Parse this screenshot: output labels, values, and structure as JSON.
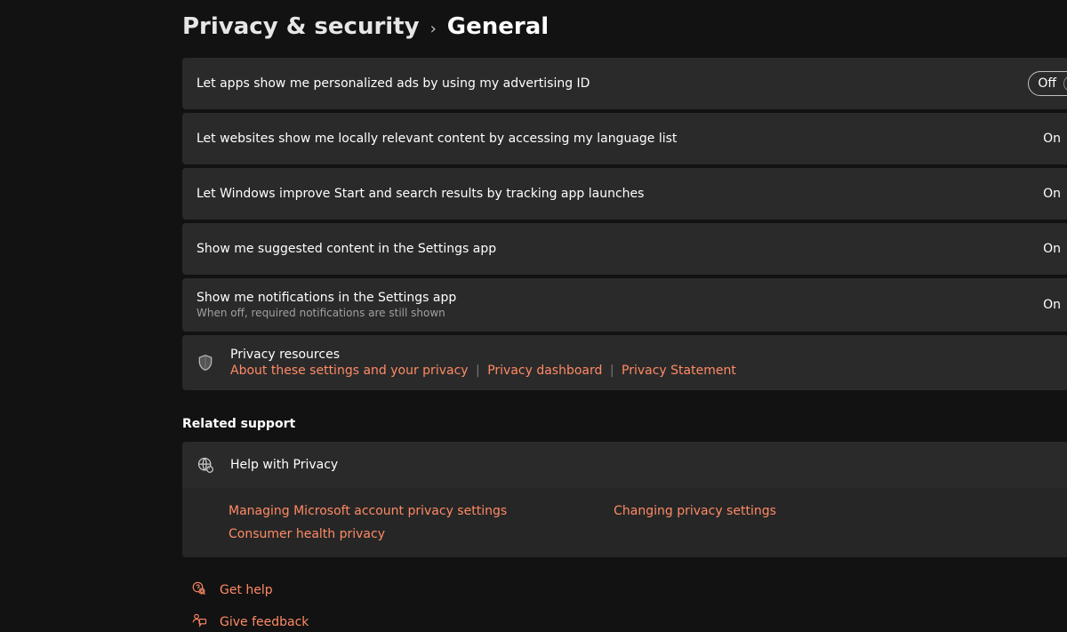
{
  "breadcrumb": {
    "parent": "Privacy & security",
    "current": "General"
  },
  "settings": [
    {
      "label": "Let apps show me personalized ads by using my advertising ID",
      "sub": "",
      "state_label": "Off",
      "on": false
    },
    {
      "label": "Let websites show me locally relevant content by accessing my language list",
      "sub": "",
      "state_label": "On",
      "on": true
    },
    {
      "label": "Let Windows improve Start and search results by tracking app launches",
      "sub": "",
      "state_label": "On",
      "on": true
    },
    {
      "label": "Show me suggested content in the Settings app",
      "sub": "",
      "state_label": "On",
      "on": true
    },
    {
      "label": "Show me notifications in the Settings app",
      "sub": "When off, required notifications are still shown",
      "state_label": "On",
      "on": true
    }
  ],
  "resources": {
    "title": "Privacy resources",
    "links": [
      "About these settings and your privacy",
      "Privacy dashboard",
      "Privacy Statement"
    ]
  },
  "related_support_title": "Related support",
  "help": {
    "title": "Help with Privacy",
    "links_col1": [
      "Managing Microsoft account privacy settings",
      "Consumer health privacy"
    ],
    "links_col2": [
      "Changing privacy settings"
    ]
  },
  "footer": {
    "get_help": "Get help",
    "give_feedback": "Give feedback"
  }
}
